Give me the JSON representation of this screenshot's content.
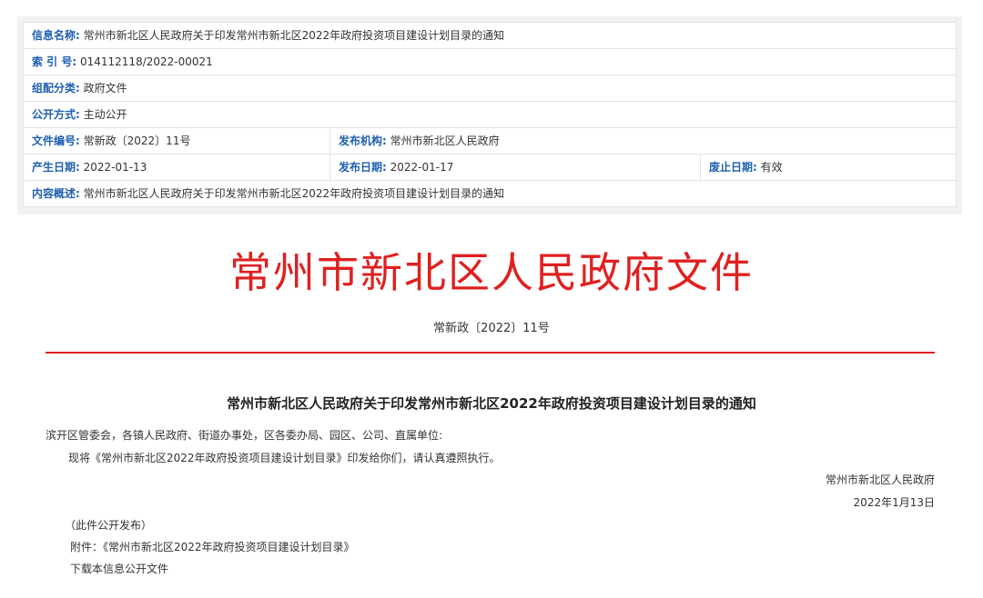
{
  "info": {
    "title_label": "信息名称:",
    "title_value": "常州市新北区人民政府关于印发常州市新北区2022年政府投资项目建设计划目录的通知",
    "index_label": "索 引 号:",
    "index_value": "014112118/2022-00021",
    "category_label": "组配分类:",
    "category_value": "政府文件",
    "disclosure_label": "公开方式:",
    "disclosure_value": "主动公开",
    "docno_label": "文件编号:",
    "docno_value": "常新政〔2022〕11号",
    "publisher_label": "发布机构:",
    "publisher_value": "常州市新北区人民政府",
    "created_label": "产生日期:",
    "created_value": "2022-01-13",
    "published_label": "发布日期:",
    "published_value": "2022-01-17",
    "expiry_label": "废止日期:",
    "expiry_value": "有效",
    "summary_label": "内容概述:",
    "summary_value": "常州市新北区人民政府关于印发常州市新北区2022年政府投资项目建设计划目录的通知"
  },
  "document": {
    "header_title": "常州市新北区人民政府文件",
    "doc_number": "常新政〔2022〕11号",
    "notice_title": "常州市新北区人民政府关于印发常州市新北区2022年政府投资项目建设计划目录的通知",
    "recipients": "滨开区管委会，各镇人民政府、街道办事处，区各委办局、园区、公司、直属单位:",
    "body": "现将《常州市新北区2022年政府投资项目建设计划目录》印发给你们，请认真遵照执行。",
    "signature": "常州市新北区人民政府",
    "date": "2022年1月13日",
    "publish_note": "（此件公开发布）",
    "attachment": "附件：《常州市新北区2022年政府投资项目建设计划目录》",
    "download": "下载本信息公开文件"
  },
  "colors": {
    "label_blue": "#1f5fb0",
    "title_red": "#e02020"
  }
}
